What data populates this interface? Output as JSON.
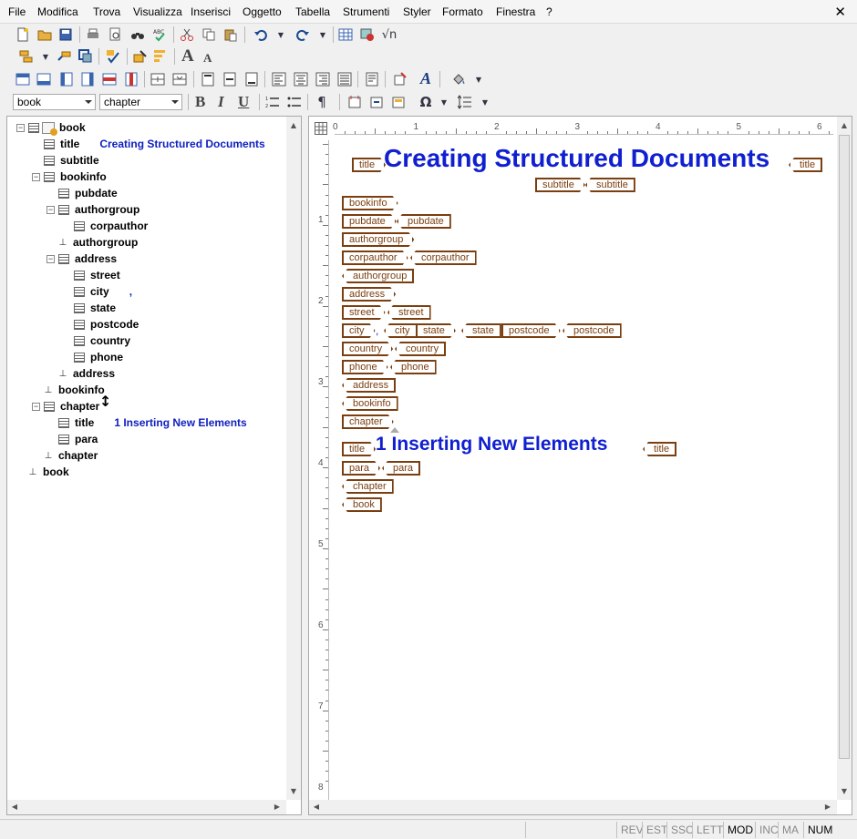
{
  "menu": [
    "File",
    "Modifica",
    "Trova",
    "Visualizza",
    "Inserisci",
    "Oggetto",
    "Tabella",
    "Strumenti",
    "Styler",
    "Formato",
    "Finestra",
    "?"
  ],
  "close_glyph": "✕",
  "toolbar": {
    "element_combo": "book",
    "style_combo": "chapter",
    "bold": "B",
    "italic": "I",
    "underline": "U",
    "pilcrow": "¶",
    "font_larger": "A",
    "font_smaller": "A",
    "omega": "Ω",
    "sqrt": "√n"
  },
  "tree": [
    {
      "label": "book",
      "level": 0,
      "kind": "open",
      "value": ""
    },
    {
      "label": "title",
      "level": 1,
      "kind": "leaf",
      "value": "Creating Structured Documents"
    },
    {
      "label": "subtitle",
      "level": 1,
      "kind": "leaf",
      "value": ""
    },
    {
      "label": "bookinfo",
      "level": 1,
      "kind": "open",
      "value": ""
    },
    {
      "label": "pubdate",
      "level": 2,
      "kind": "leaf",
      "value": ""
    },
    {
      "label": "authorgroup",
      "level": 2,
      "kind": "open",
      "value": ""
    },
    {
      "label": "corpauthor",
      "level": 3,
      "kind": "leaf",
      "value": ""
    },
    {
      "label": "authorgroup",
      "level": 2,
      "kind": "end",
      "value": ""
    },
    {
      "label": "address",
      "level": 2,
      "kind": "open",
      "value": ""
    },
    {
      "label": "street",
      "level": 3,
      "kind": "leaf",
      "value": ""
    },
    {
      "label": "city",
      "level": 3,
      "kind": "leaf",
      "value": ","
    },
    {
      "label": "state",
      "level": 3,
      "kind": "leaf",
      "value": ""
    },
    {
      "label": "postcode",
      "level": 3,
      "kind": "leaf",
      "value": ""
    },
    {
      "label": "country",
      "level": 3,
      "kind": "leaf",
      "value": ""
    },
    {
      "label": "phone",
      "level": 3,
      "kind": "leaf",
      "value": ""
    },
    {
      "label": "address",
      "level": 2,
      "kind": "end",
      "value": ""
    },
    {
      "label": "bookinfo",
      "level": 1,
      "kind": "end",
      "value": ""
    },
    {
      "label": "chapter",
      "level": 1,
      "kind": "open",
      "value": ""
    },
    {
      "label": "title",
      "level": 2,
      "kind": "leaf",
      "value": "1 Inserting New Elements"
    },
    {
      "label": "para",
      "level": 2,
      "kind": "leaf",
      "value": ""
    },
    {
      "label": "chapter",
      "level": 1,
      "kind": "end",
      "value": ""
    },
    {
      "label": "book",
      "level": 0,
      "kind": "end",
      "value": ""
    }
  ],
  "ruler": {
    "top_numbers": [
      "0",
      "1",
      "2",
      "3",
      "4",
      "5",
      "6"
    ],
    "left_numbers": [
      "1",
      "2",
      "3",
      "4",
      "5",
      "6",
      "7",
      "8"
    ]
  },
  "document": {
    "title": "Creating Structured Documents",
    "chapter_title": "1 Inserting New Elements",
    "comma": ",",
    "tags": {
      "title": "title",
      "subtitle": "subtitle",
      "bookinfo": "bookinfo",
      "pubdate": "pubdate",
      "authorgroup": "authorgroup",
      "corpauthor": "corpauthor",
      "address": "address",
      "street": "street",
      "city": "city",
      "state": "state",
      "postcode": "postcode",
      "country": "country",
      "phone": "phone",
      "chapter": "chapter",
      "para": "para",
      "book": "book"
    }
  },
  "status": [
    "REV",
    "EST",
    "SSC",
    "LETT",
    "MOD",
    "INC",
    "MA",
    "NUM"
  ],
  "status_active": [
    "MOD",
    "NUM"
  ]
}
